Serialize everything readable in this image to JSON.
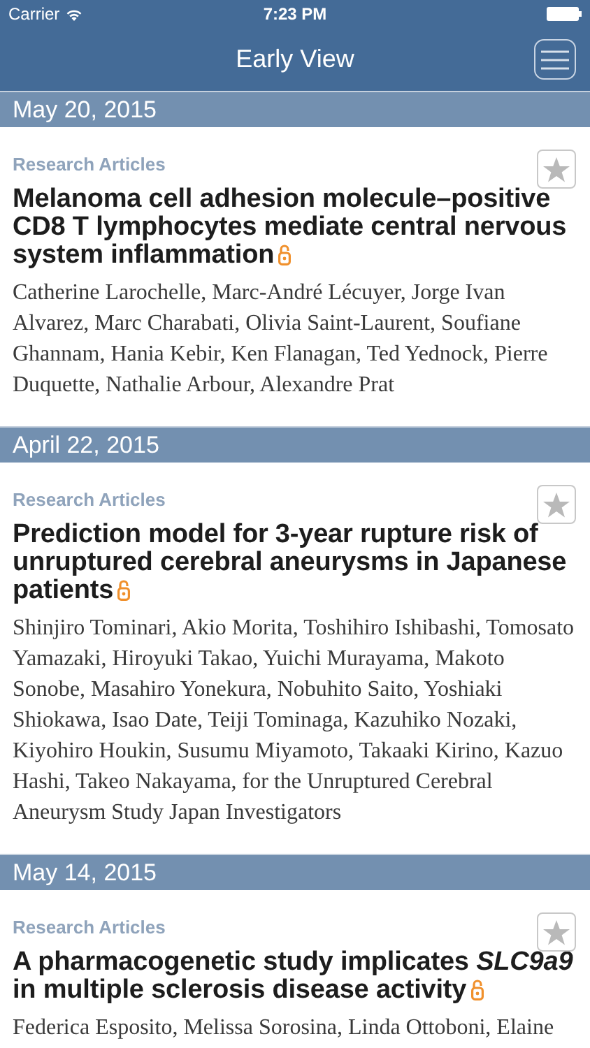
{
  "status_bar": {
    "carrier": "Carrier",
    "time": "7:23 PM"
  },
  "nav": {
    "title": "Early View"
  },
  "sections": [
    {
      "date": "May 20, 2015",
      "articles": [
        {
          "category": "Research Articles",
          "title": "Melanoma cell adhesion molecule–positive CD8 T lymphocytes mediate central nervous system inflammation",
          "open_access": true,
          "starred": false,
          "authors": "Catherine Larochelle, Marc-André Lécuyer, Jorge Ivan Alvarez, Marc Charabati, Olivia Saint-Laurent, Soufiane Ghannam, Hania Kebir, Ken Flanagan, Ted Yednock, Pierre Duquette, Nathalie Arbour, Alexandre Prat"
        }
      ]
    },
    {
      "date": "April 22, 2015",
      "articles": [
        {
          "category": "Research Articles",
          "title": "Prediction model for 3-year rupture risk of unruptured cerebral aneurysms in Japanese patients",
          "open_access": true,
          "starred": false,
          "authors": "Shinjiro Tominari, Akio Morita, Toshihiro Ishibashi, Tomosato Yamazaki, Hiroyuki Takao, Yuichi Murayama, Makoto Sonobe, Masahiro Yonekura, Nobuhito Saito, Yoshiaki Shiokawa, Isao Date, Teiji Tominaga, Kazuhiko Nozaki, Kiyohiro Houkin, Susumu Miyamoto, Takaaki Kirino, Kazuo Hashi, Takeo Nakayama, for the Unruptured Cerebral Aneurysm Study Japan Investigators"
        }
      ]
    },
    {
      "date": "May 14, 2015",
      "articles": [
        {
          "category": "Research Articles",
          "title": "A pharmacogenetic study implicates *SLC9a9* in multiple sclerosis disease activity",
          "open_access": true,
          "starred": false,
          "authors": "Federica Esposito, Melissa Sorosina, Linda Ottoboni, Elaine"
        }
      ]
    }
  ]
}
